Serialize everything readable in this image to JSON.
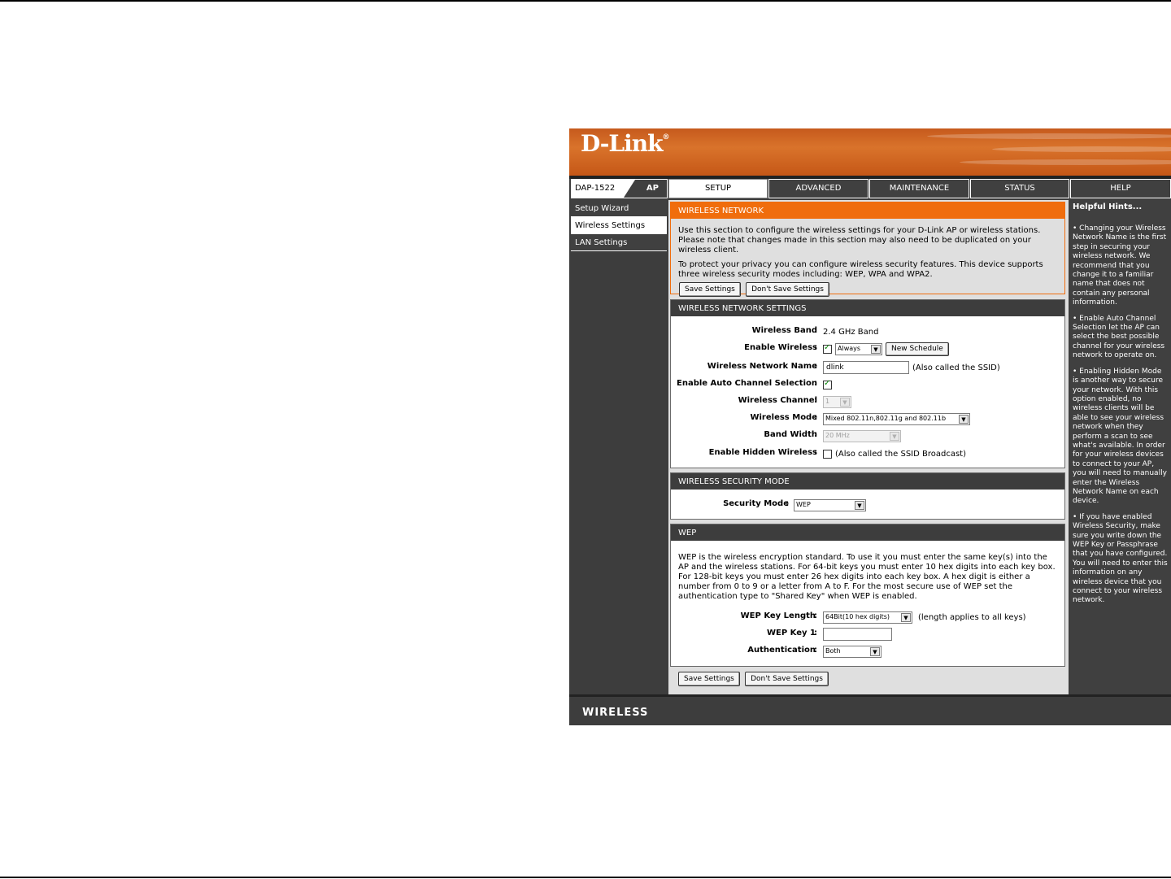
{
  "brand": {
    "logo": "D-Link",
    "registered": "®"
  },
  "model": {
    "name": "DAP-1522",
    "mode": "AP"
  },
  "tabs": [
    {
      "label": "SETUP"
    },
    {
      "label": "ADVANCED"
    },
    {
      "label": "MAINTENANCE"
    },
    {
      "label": "STATUS"
    },
    {
      "label": "HELP"
    }
  ],
  "nav": [
    {
      "label": "Setup Wizard"
    },
    {
      "label": "Wireless Settings"
    },
    {
      "label": "LAN Settings"
    }
  ],
  "wireless_network": {
    "title": "WIRELESS NETWORK",
    "para1": "Use this section to configure the wireless settings for your D-Link AP or wireless stations. Please note that changes made in this section may also need to be duplicated on your wireless client.",
    "para2": "To protect your privacy you can configure wireless security features. This device supports three wireless security modes including: WEP, WPA and WPA2.",
    "save_label": "Save Settings",
    "dont_save_label": "Don't Save Settings"
  },
  "settings": {
    "title": "WIRELESS NETWORK SETTINGS",
    "band_label": "Wireless Band",
    "band_value": "2.4 GHz Band",
    "enable_label": "Enable Wireless",
    "schedule_value": "Always",
    "new_schedule_label": "New Schedule",
    "ssid_label": "Wireless Network Name",
    "ssid_value": "dlink",
    "ssid_note": "(Also called the SSID)",
    "auto_channel_label": "Enable Auto Channel Selection",
    "channel_label": "Wireless Channel",
    "channel_value": "1",
    "mode_label": "Wireless Mode",
    "mode_value": "Mixed 802.11n,802.11g and 802.11b",
    "bandwidth_label": "Band Width",
    "bandwidth_value": "20 MHz",
    "hidden_label": "Enable Hidden Wireless",
    "hidden_note": "(Also called the SSID Broadcast)",
    "colon": ":"
  },
  "security": {
    "title": "WIRELESS SECURITY MODE",
    "mode_label": "Security Mode",
    "mode_value": "WEP"
  },
  "wep": {
    "title": "WEP",
    "description": "WEP is the wireless encryption standard. To use it you must enter the same key(s) into the AP and the wireless stations. For 64-bit keys you must enter 10 hex digits into each key box. For 128-bit keys you must enter 26 hex digits into each key box. A hex digit is either a number from 0 to 9 or a letter from A to F. For the most secure use of WEP set the authentication type to \"Shared Key\" when WEP is enabled.",
    "key_length_label": "WEP Key Length",
    "key_length_value": "64Bit(10 hex digits)",
    "key_length_note": "(length applies to all keys)",
    "key1_label": "WEP Key 1",
    "key1_value": "",
    "auth_label": "Authentication",
    "auth_value": "Both"
  },
  "bottom_buttons": {
    "save_label": "Save Settings",
    "dont_save_label": "Don't Save Settings"
  },
  "hints": {
    "title": "Helpful Hints...",
    "items": [
      "• Changing your Wireless Network Name is the first step in securing your wireless network. We recommend that you change it to a familiar name that does not contain any personal information.",
      "• Enable Auto Channel Selection let the AP can select the best possible channel for your wireless network to operate on.",
      "• Enabling Hidden Mode is another way to secure your network. With this option enabled, no wireless clients will be able to see your wireless network when they perform a scan to see what's available. In order for your wireless devices to connect to your AP, you will need to manually enter the Wireless Network Name on each device.",
      "• If you have enabled Wireless Security, make sure you write down the WEP Key or Passphrase that you have configured. You will need to enter this information on any wireless device that you connect to your wireless network."
    ]
  },
  "footer": {
    "label": "WIRELESS"
  },
  "colors": {
    "accent": "#f06d0d",
    "dark": "#3d3d3d",
    "panel": "#dfdfdf"
  }
}
